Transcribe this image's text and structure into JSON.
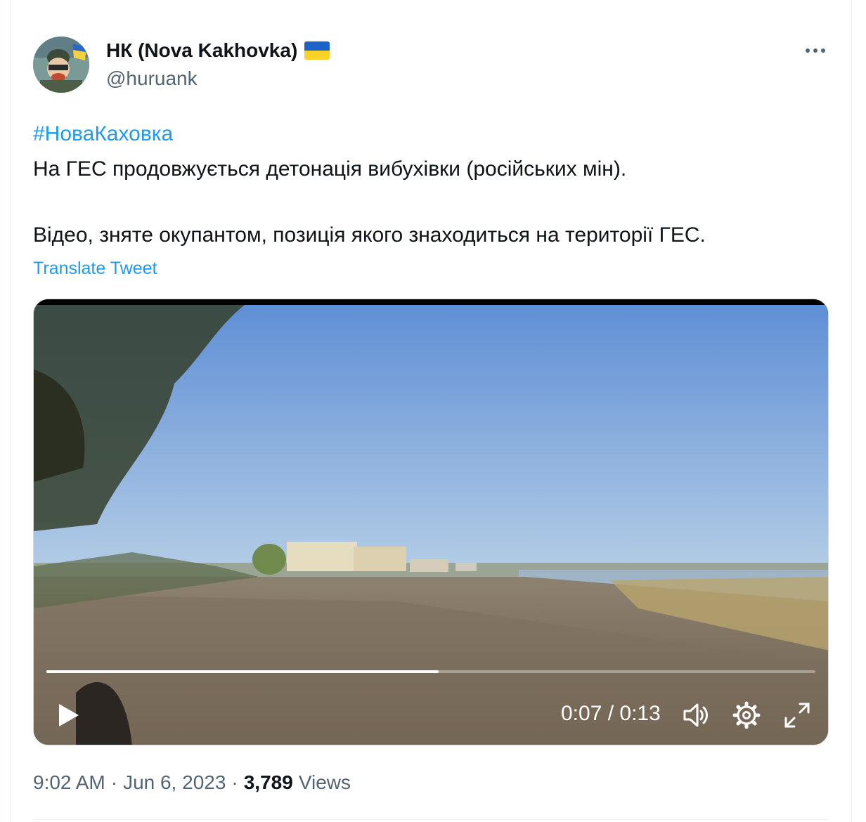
{
  "tweet": {
    "display_name": "НК (Nova Kakhovka)",
    "handle": "@huruank",
    "hashtag": "#НоваКаховка",
    "text_line_1": "На ГЕС продовжується детонація вибухівки (російських мін).",
    "text_line_2": "Відео, зняте окупантом, позиція якого знаходиться на території ГЕС.",
    "translate_label": "Translate Tweet",
    "timestamp": "9:02 AM",
    "separator": "·",
    "date": "Jun 6, 2023",
    "views_count": "3,789",
    "views_label": "Views"
  },
  "video": {
    "time_display": "0:07 / 0:13",
    "progress_fraction": 0.51
  },
  "icons": {
    "flag": "ukraine-flag-icon",
    "more": "more-icon",
    "play": "play-icon",
    "volume": "volume-icon",
    "settings": "gear-icon",
    "fullscreen": "fullscreen-icon"
  },
  "colors": {
    "link": "#1d9bf0",
    "text": "#0f1419",
    "muted": "#536471"
  }
}
